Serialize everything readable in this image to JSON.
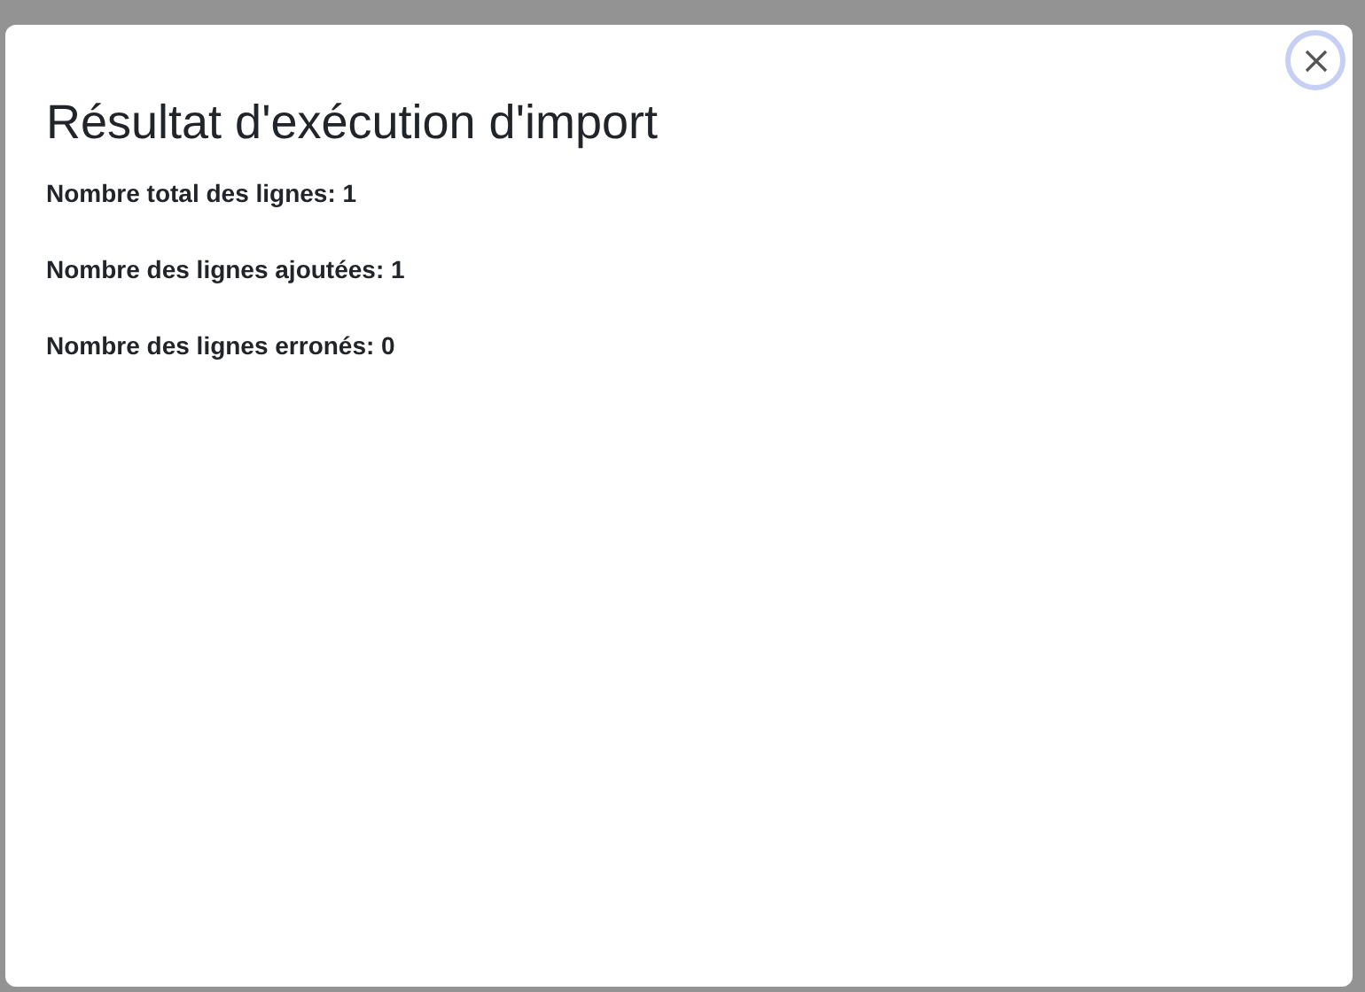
{
  "dialog": {
    "title": "Résultat d'exécution d'import",
    "lines": [
      "Nombre total des lignes: 1",
      "Nombre des lignes ajoutées: 1",
      "Nombre des lignes erronés: 0"
    ]
  }
}
